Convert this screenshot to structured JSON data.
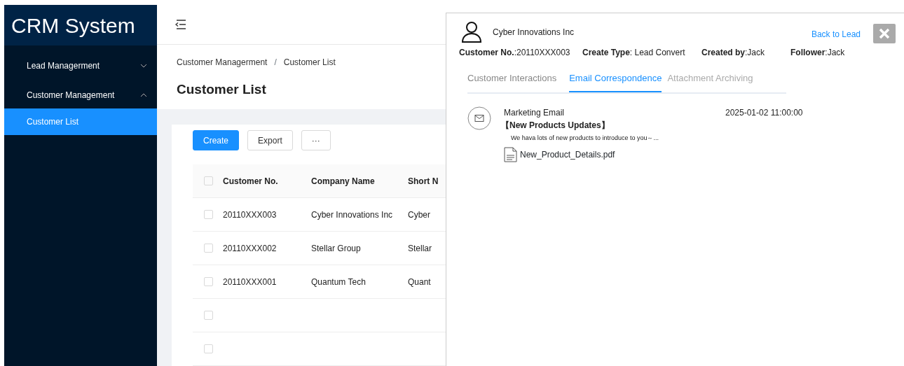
{
  "sidebar": {
    "logo": "CRM System",
    "items": [
      {
        "label": "Lead Managerment",
        "expanded": false
      },
      {
        "label": "Customer Management",
        "expanded": true,
        "children": [
          {
            "label": "Customer List",
            "selected": true
          }
        ]
      }
    ]
  },
  "breadcrumb": [
    "Customer Managerment",
    "/",
    "Customer List"
  ],
  "page_title": "Customer List",
  "toolbar": [
    {
      "kind": "primary",
      "label": "Create"
    },
    {
      "kind": "default",
      "label": "Export"
    },
    {
      "kind": "default",
      "label": "···"
    }
  ],
  "table": {
    "header_checked": false,
    "columns": [
      "Customer No.",
      "Company Name",
      "Short N"
    ],
    "rows": [
      {
        "checked": false,
        "cells": [
          "20110XXX003",
          "Cyber Innovations Inc",
          "Cyber"
        ]
      },
      {
        "checked": false,
        "cells": [
          "20110XXX002",
          "Stellar Group",
          "Stellar"
        ]
      },
      {
        "checked": false,
        "cells": [
          "20110XXX001",
          "Quantum Tech",
          "Quant"
        ]
      },
      {
        "checked": false,
        "cells": []
      },
      {
        "checked": false,
        "cells": []
      }
    ]
  },
  "drawer": {
    "company": "Cyber Innovations Inc",
    "back_link": "Back to Lead",
    "info": [
      {
        "label": "Customer No.",
        "value": ":20110XXX003"
      },
      {
        "label": "Create Type",
        "value": ": Lead Convert"
      },
      {
        "label": "Created by",
        "value": ":Jack"
      },
      {
        "label": "Follower",
        "value": ":Jack"
      }
    ],
    "tabs": [
      {
        "label": "Customer Interactions",
        "selected": false
      },
      {
        "label": "Email Correspondence",
        "selected": true
      },
      {
        "label": "Attachment Archiving",
        "selected": false
      }
    ],
    "emails": [
      {
        "type": "Marketing Email",
        "subject": "【New Products Updates】",
        "preview": "We hava lots of new products to introduce to you～...",
        "time": "2025-01-02 11:00:00",
        "attachment": "New_Product_Details.pdf"
      }
    ]
  }
}
